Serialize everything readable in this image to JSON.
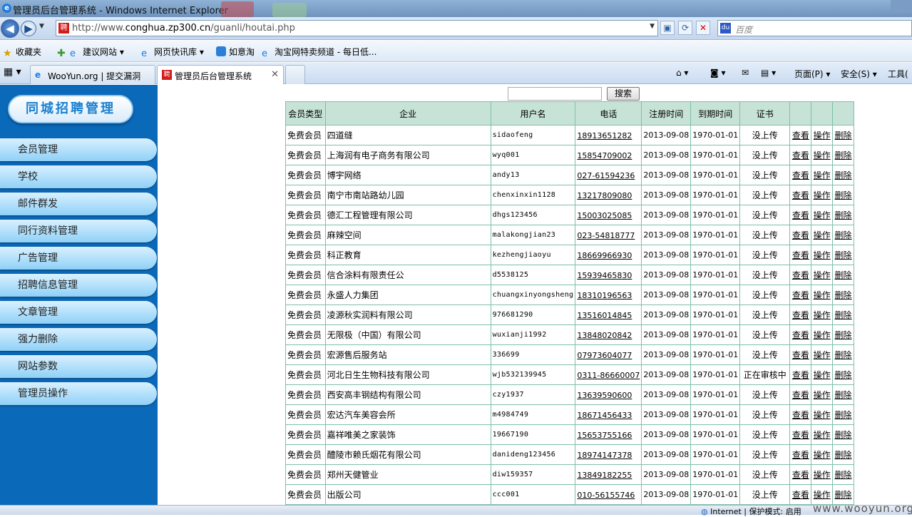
{
  "window": {
    "title": "管理员后台管理系统 - Windows Internet Explorer"
  },
  "address": {
    "url_prefix": "http://www.",
    "url_host": "conghua.zp300.cn",
    "url_path": "/guanli/houtai.php",
    "search_placeholder": "百度"
  },
  "favorites": {
    "label": "收藏夹",
    "items": [
      "建议网站 ▾",
      "网页快讯库 ▾",
      "如意淘",
      "淘宝网特卖频道 - 每日低..."
    ]
  },
  "tabs": [
    {
      "label": "WooYun.org | 提交漏洞"
    },
    {
      "label": "管理员后台管理系统"
    }
  ],
  "commands": {
    "page": "页面(P) ▾",
    "safety": "安全(S) ▾",
    "tools": "工具("
  },
  "sidebar": {
    "logo": "同城招聘管理",
    "items": [
      "会员管理",
      "学校",
      "邮件群发",
      "同行资料管理",
      "广告管理",
      "招聘信息管理",
      "文章管理",
      "强力删除",
      "网站参数",
      "管理员操作"
    ]
  },
  "search": {
    "button": "搜索"
  },
  "table": {
    "headers": [
      "会员类型",
      "企业",
      "用户名",
      "电话",
      "注册时间",
      "到期时间",
      "证书",
      "",
      "",
      ""
    ],
    "rows": [
      [
        "免费会员",
        "四道缝",
        "sidaofeng",
        "18913651282",
        "2013-09-08",
        "1970-01-01",
        "没上传",
        "查看",
        "操作",
        "删除"
      ],
      [
        "免费会员",
        "上海润有电子商务有限公司",
        "wyq001",
        "15854709002",
        "2013-09-08",
        "1970-01-01",
        "没上传",
        "查看",
        "操作",
        "删除"
      ],
      [
        "免费会员",
        "博宇网络",
        "andy13",
        "027-61594236",
        "2013-09-08",
        "1970-01-01",
        "没上传",
        "查看",
        "操作",
        "删除"
      ],
      [
        "免费会员",
        "南宁市南站路幼儿园",
        "chenxinxin1128",
        "13217809080",
        "2013-09-08",
        "1970-01-01",
        "没上传",
        "查看",
        "操作",
        "删除"
      ],
      [
        "免费会员",
        "德汇工程管理有限公司",
        "dhgs123456",
        "15003025085",
        "2013-09-08",
        "1970-01-01",
        "没上传",
        "查看",
        "操作",
        "删除"
      ],
      [
        "免费会员",
        "麻辣空间",
        "malakongjian23",
        "023-54818777",
        "2013-09-08",
        "1970-01-01",
        "没上传",
        "查看",
        "操作",
        "删除"
      ],
      [
        "免费会员",
        "科正教育",
        "kezhengjiaoyu",
        "18669966930",
        "2013-09-08",
        "1970-01-01",
        "没上传",
        "查看",
        "操作",
        "删除"
      ],
      [
        "免费会员",
        "信合涂料有限责任公",
        "d5538125",
        "15939465830",
        "2013-09-08",
        "1970-01-01",
        "没上传",
        "查看",
        "操作",
        "删除"
      ],
      [
        "免费会员",
        "永盛人力集团",
        "chuangxinyongsheng",
        "18310196563",
        "2013-09-08",
        "1970-01-01",
        "没上传",
        "查看",
        "操作",
        "删除"
      ],
      [
        "免费会员",
        "凌源秋实润料有限公司",
        "976681290",
        "13516014845",
        "2013-09-08",
        "1970-01-01",
        "没上传",
        "查看",
        "操作",
        "删除"
      ],
      [
        "免费会员",
        "无限极（中国）有限公司",
        "wuxianji1992",
        "13848020842",
        "2013-09-08",
        "1970-01-01",
        "没上传",
        "查看",
        "操作",
        "删除"
      ],
      [
        "免费会员",
        "宏源售后服务站",
        "336699",
        "07973604077",
        "2013-09-08",
        "1970-01-01",
        "没上传",
        "查看",
        "操作",
        "删除"
      ],
      [
        "免费会员",
        "河北日生生物科技有限公司",
        "wjb532139945",
        "0311-86660007",
        "2013-09-08",
        "1970-01-01",
        "正在审核中",
        "查看",
        "操作",
        "删除"
      ],
      [
        "免费会员",
        "西安高丰钢结构有限公司",
        "czy1937",
        "13639590600",
        "2013-09-08",
        "1970-01-01",
        "没上传",
        "查看",
        "操作",
        "删除"
      ],
      [
        "免费会员",
        "宏达汽车美容会所",
        "m4984749",
        "18671456433",
        "2013-09-08",
        "1970-01-01",
        "没上传",
        "查看",
        "操作",
        "删除"
      ],
      [
        "免费会员",
        "嘉祥唯美之家装饰",
        "19667190",
        "15653755166",
        "2013-09-08",
        "1970-01-01",
        "没上传",
        "查看",
        "操作",
        "删除"
      ],
      [
        "免费会员",
        "醴陵市赖氏烟花有限公司",
        "danideng123456",
        "18974147378",
        "2013-09-08",
        "1970-01-01",
        "没上传",
        "查看",
        "操作",
        "删除"
      ],
      [
        "免费会员",
        "郑州天健管业",
        "diw159357",
        "13849182255",
        "2013-09-08",
        "1970-01-01",
        "没上传",
        "查看",
        "操作",
        "删除"
      ],
      [
        "免费会员",
        "出版公司",
        "ccc001",
        "010-56155746",
        "2013-09-08",
        "1970-01-01",
        "没上传",
        "查看",
        "操作",
        "删除"
      ]
    ]
  },
  "status": {
    "zone": "Internet | 保护模式: 启用",
    "watermark": "www.wooyun.org"
  },
  "colors": {
    "sidebar_bg": "#0b69b9",
    "table_border": "#7fbfa6",
    "header_bg": "#c7e3d7"
  }
}
